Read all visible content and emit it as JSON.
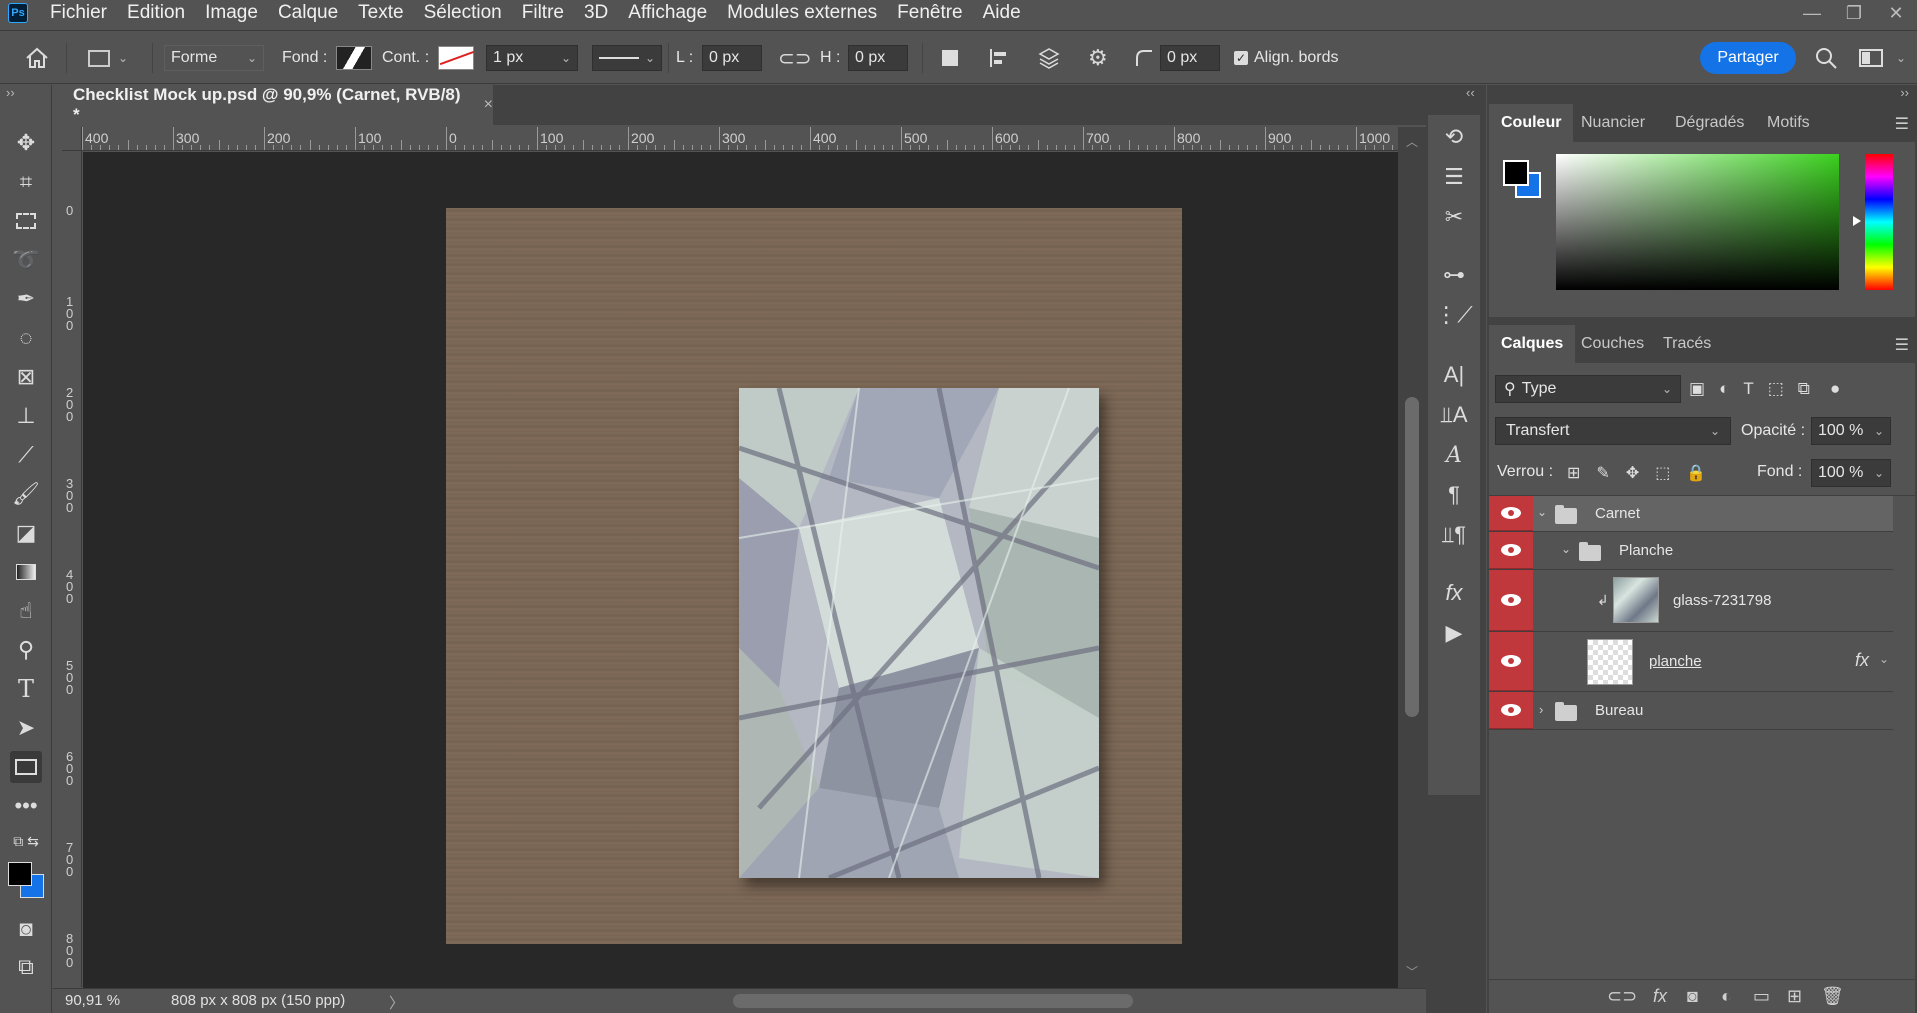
{
  "app": {
    "logo": "Ps"
  },
  "menu": [
    "Fichier",
    "Edition",
    "Image",
    "Calque",
    "Texte",
    "Sélection",
    "Filtre",
    "3D",
    "Affichage",
    "Modules externes",
    "Fenêtre",
    "Aide"
  ],
  "window_controls": {
    "minimize": "—",
    "restore": "❐",
    "close": "✕"
  },
  "options_bar": {
    "mode_value": "Forme",
    "fill_label": "Fond :",
    "stroke_label": "Cont. :",
    "stroke_width": "1 px",
    "w_label": "L :",
    "w_value": "0 px",
    "h_label": "H :",
    "h_value": "0 px",
    "radius_value": "0 px",
    "align_edges_label": "Align. bords",
    "share_label": "Partager"
  },
  "document": {
    "tab_title": "Checklist Mock up.psd @ 90,9% (Carnet, RVB/8) *",
    "close_glyph": "×"
  },
  "ruler": {
    "h_labels": [
      "400",
      "300",
      "200",
      "100",
      "0",
      "100",
      "200",
      "300",
      "400",
      "500",
      "600",
      "700",
      "800",
      "900",
      "1000"
    ],
    "v_labels": [
      "0",
      "100",
      "200",
      "300",
      "400",
      "500",
      "600",
      "700",
      "800"
    ]
  },
  "status": {
    "zoom": "90,91 %",
    "dimensions": "808 px x 808 px (150 ppp)",
    "arrow": "〉"
  },
  "color_panel": {
    "tabs": [
      "Couleur",
      "Nuancier",
      "Dégradés",
      "Motifs"
    ],
    "foreground": "#000000",
    "background": "#1473e6"
  },
  "layers_panel": {
    "tabs": [
      "Calques",
      "Couches",
      "Tracés"
    ],
    "filter_value": "Type",
    "blend_mode": "Transfert",
    "opacity_label": "Opacité :",
    "opacity_value": "100 %",
    "lock_label": "Verrou :",
    "fill_label": "Fond :",
    "fill_value": "100 %",
    "layers": [
      {
        "name": "Carnet",
        "type": "group",
        "expanded": true
      },
      {
        "name": "Planche",
        "type": "group",
        "expanded": true
      },
      {
        "name": "glass-7231798",
        "type": "smart-object",
        "clipped": true
      },
      {
        "name": "planche",
        "type": "shape",
        "fx": "fx"
      },
      {
        "name": "Bureau",
        "type": "group",
        "expanded": false
      }
    ]
  },
  "colors": {
    "accent": "#1473e6",
    "visibility_red": "#c1383c",
    "panel_bg": "#535353",
    "canvas_bg": "#282828"
  }
}
